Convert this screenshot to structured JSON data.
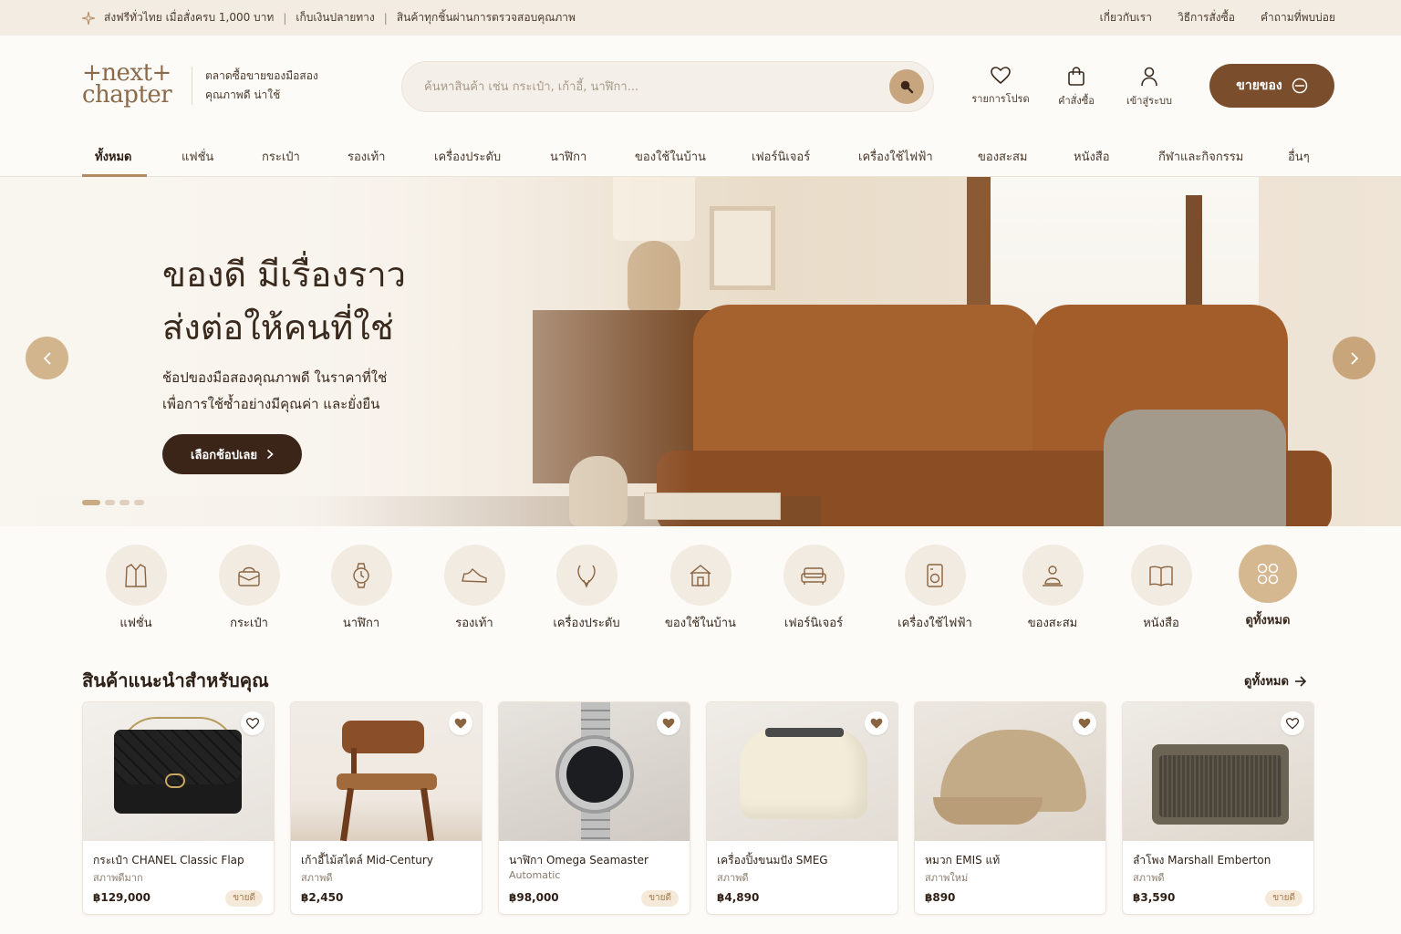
{
  "topbar": {
    "messages": [
      "ส่งฟรีทั่วไทย เมื่อสั่งครบ 1,000 บาท",
      "เก็บเงินปลายทาง",
      "สินค้าทุกชิ้นผ่านการตรวจสอบคุณภาพ"
    ],
    "links": [
      "เกี่ยวกับเรา",
      "วิธีการสั่งซื้อ",
      "คำถามที่พบบ่อย"
    ]
  },
  "header": {
    "logo_line1": "+next+",
    "logo_line2": "chapter",
    "tagline_line1": "ตลาดซื้อขายของมือสอง",
    "tagline_line2": "คุณภาพดี น่าใช้",
    "search_placeholder": "ค้นหาสินค้า เช่น กระเป๋า, เก้าอี้, นาฬิกา...",
    "icons": [
      {
        "label": "รายการโปรด",
        "icon": "heart-icon"
      },
      {
        "label": "คำสั่งซื้อ",
        "icon": "shopping-bag-icon"
      },
      {
        "label": "เข้าสู่ระบบ",
        "icon": "user-icon"
      }
    ],
    "sell_label": "ขายของ"
  },
  "nav": {
    "items": [
      "ทั้งหมด",
      "แฟชั่น",
      "กระเป๋า",
      "รองเท้า",
      "เครื่องประดับ",
      "นาฬิกา",
      "ของใช้ในบ้าน",
      "เฟอร์นิเจอร์",
      "เครื่องใช้ไฟฟ้า",
      "ของสะสม",
      "หนังสือ",
      "กีฬาและกิจกรรม",
      "อื่นๆ"
    ],
    "active_index": 0
  },
  "hero": {
    "title_line1": "ของดี มีเรื่องราว",
    "title_line2": "ส่งต่อให้คนที่ใช่",
    "subtitle_line1": "ช้อปของมือสองคุณภาพดี ในราคาที่ใช่",
    "subtitle_line2": "เพื่อการใช้ซ้ำอย่างมีคุณค่า และยั่งยืน",
    "cta_label": "เลือกช้อปเลย",
    "slide_count": 4,
    "active_slide": 0
  },
  "categories": [
    {
      "label": "แฟชั่น",
      "icon": "shirt-icon"
    },
    {
      "label": "กระเป๋า",
      "icon": "bag-icon"
    },
    {
      "label": "นาฬิกา",
      "icon": "watch-icon"
    },
    {
      "label": "รองเท้า",
      "icon": "shoe-icon"
    },
    {
      "label": "เครื่องประดับ",
      "icon": "jewelry-icon"
    },
    {
      "label": "ของใช้ในบ้าน",
      "icon": "home-icon"
    },
    {
      "label": "เฟอร์นิเจอร์",
      "icon": "sofa-icon"
    },
    {
      "label": "เครื่องใช้ไฟฟ้า",
      "icon": "appliance-icon"
    },
    {
      "label": "ของสะสม",
      "icon": "collectible-icon"
    },
    {
      "label": "หนังสือ",
      "icon": "book-icon"
    },
    {
      "label": "ดูทั้งหมด",
      "icon": "grid-icon"
    }
  ],
  "section": {
    "title": "สินค้าแนะนำสำหรับคุณ",
    "see_all": "ดูทั้งหมด"
  },
  "products": [
    {
      "name": "กระเป๋า CHANEL Classic Flap",
      "condition": "สภาพดีมาก",
      "price": "฿129,000",
      "badge": "ขายดี",
      "favorited": false
    },
    {
      "name": "เก้าอี้ไม้สไตล์ Mid-Century",
      "condition": "สภาพดี",
      "price": "฿2,450",
      "badge": "",
      "favorited": true
    },
    {
      "name": "นาฬิกา Omega Seamaster",
      "condition": "Automatic",
      "price": "฿98,000",
      "badge": "ขายดี",
      "favorited": true
    },
    {
      "name": "เครื่องปิ้งขนมปัง SMEG",
      "condition": "สภาพดี",
      "price": "฿4,890",
      "badge": "",
      "favorited": true
    },
    {
      "name": "หมวก EMIS แท้",
      "condition": "สภาพใหม่",
      "price": "฿890",
      "badge": "",
      "favorited": true
    },
    {
      "name": "ลำโพง Marshall Emberton",
      "condition": "สภาพดี",
      "price": "฿3,590",
      "badge": "ขายดี",
      "favorited": false
    }
  ],
  "colors": {
    "brand": "#7a4e2c",
    "accent": "#c9a57c",
    "dark": "#3b2518",
    "topbar_bg": "#f3ece2"
  }
}
